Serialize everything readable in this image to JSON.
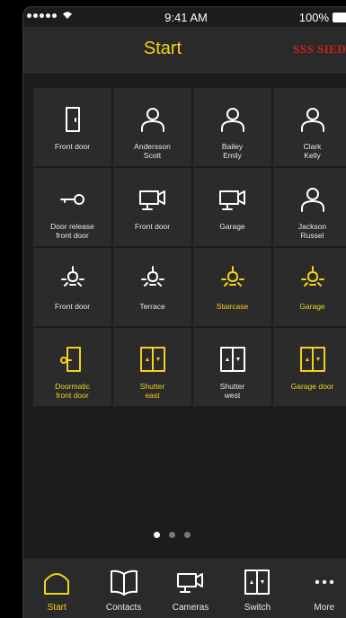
{
  "status_bar": {
    "time": "9:41 AM",
    "battery": "100%"
  },
  "header": {
    "title": "Start",
    "logo": "SSS SIEDLE"
  },
  "tiles": [
    {
      "label": "Front door",
      "icon": "door-icon",
      "active": false
    },
    {
      "label": "Andersson\nScott",
      "icon": "person-icon",
      "active": false
    },
    {
      "label": "Bailey\nEmily",
      "icon": "person-icon",
      "active": false
    },
    {
      "label": "Clark\nKelly",
      "icon": "person-icon",
      "active": false
    },
    {
      "label": "Door release\nfront door",
      "icon": "key-icon",
      "active": false
    },
    {
      "label": "Front door",
      "icon": "camera-icon",
      "active": false
    },
    {
      "label": "Garage",
      "icon": "camera-icon",
      "active": false
    },
    {
      "label": "Jackson\nRussel",
      "icon": "person-icon",
      "active": false
    },
    {
      "label": "Front door",
      "icon": "light-icon",
      "active": false
    },
    {
      "label": "Terrace",
      "icon": "light-icon",
      "active": false
    },
    {
      "label": "Staircase",
      "icon": "light-icon",
      "active": true
    },
    {
      "label": "Garage",
      "icon": "light-icon",
      "active": true
    },
    {
      "label": "Doormatic\nfront door",
      "icon": "doormatic-icon",
      "active": true
    },
    {
      "label": "Shutter\neast",
      "icon": "shutter-icon",
      "active": true
    },
    {
      "label": "Shutter\nwest",
      "icon": "shutter-icon",
      "active": false
    },
    {
      "label": "Garage door",
      "icon": "shutter-icon",
      "active": true
    }
  ],
  "pager": {
    "pages": 3,
    "current": 0
  },
  "tabs": [
    {
      "label": "Start",
      "icon": "home-icon",
      "active": true
    },
    {
      "label": "Contacts",
      "icon": "book-icon",
      "active": false
    },
    {
      "label": "Cameras",
      "icon": "camera-icon",
      "active": false
    },
    {
      "label": "Switch",
      "icon": "shutter-icon",
      "active": false
    },
    {
      "label": "More",
      "icon": "more-icon",
      "active": false
    }
  ],
  "colors": {
    "accent": "#f2d21b",
    "inactive": "#ffffff",
    "logo": "#d02020"
  }
}
